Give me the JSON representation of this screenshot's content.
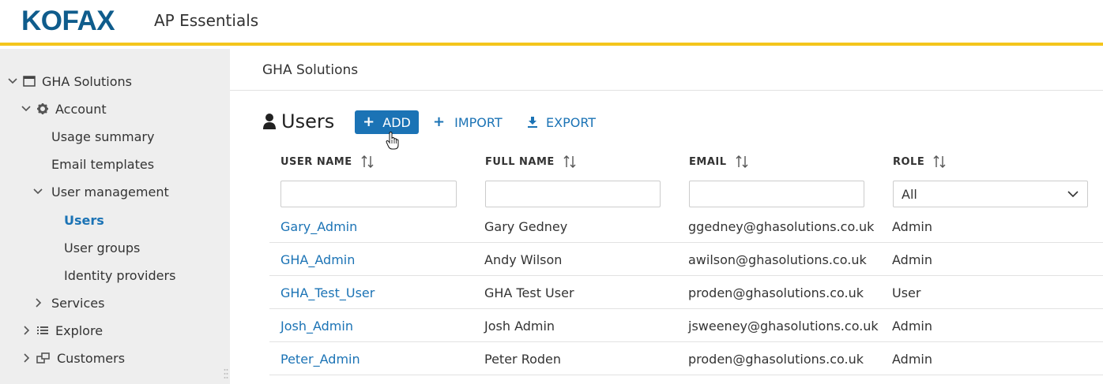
{
  "header": {
    "logo": "KOFAX",
    "app_title": "AP Essentials"
  },
  "colors": {
    "brand": "#0f5c8c",
    "accent": "#1b73b5",
    "header_rule": "#f4c51c",
    "sidebar_bg": "#eeeeee"
  },
  "sidebar": {
    "root": {
      "label": "GHA Solutions",
      "icon": "window-icon"
    },
    "account": {
      "label": "Account",
      "icon": "gear-icon"
    },
    "account_items": [
      "Usage summary",
      "Email templates"
    ],
    "user_management": {
      "label": "User management"
    },
    "user_management_items": [
      "Users",
      "User groups",
      "Identity providers"
    ],
    "services": {
      "label": "Services"
    },
    "explore": {
      "label": "Explore",
      "icon": "list-icon"
    },
    "customers": {
      "label": "Customers",
      "icon": "customers-icon"
    },
    "active_item": "Users"
  },
  "main": {
    "breadcrumb": "GHA Solutions",
    "section_title": "Users",
    "buttons": {
      "add": "ADD",
      "import": "IMPORT",
      "export": "EXPORT"
    }
  },
  "table": {
    "columns": [
      "USER NAME",
      "FULL NAME",
      "EMAIL",
      "ROLE"
    ],
    "role_filter_value": "All",
    "rows": [
      {
        "user_name": "Gary_Admin",
        "full_name": "Gary Gedney",
        "email": "ggedney@ghasolutions.co.uk",
        "role": "Admin"
      },
      {
        "user_name": "GHA_Admin",
        "full_name": "Andy Wilson",
        "email": "awilson@ghasolutions.co.uk",
        "role": "Admin"
      },
      {
        "user_name": "GHA_Test_User",
        "full_name": "GHA Test User",
        "email": "proden@ghasolutions.co.uk",
        "role": "User"
      },
      {
        "user_name": "Josh_Admin",
        "full_name": "Josh Admin",
        "email": "jsweeney@ghasolutions.co.uk",
        "role": "Admin"
      },
      {
        "user_name": "Peter_Admin",
        "full_name": "Peter Roden",
        "email": "proden@ghasolutions.co.uk",
        "role": "Admin"
      }
    ]
  }
}
